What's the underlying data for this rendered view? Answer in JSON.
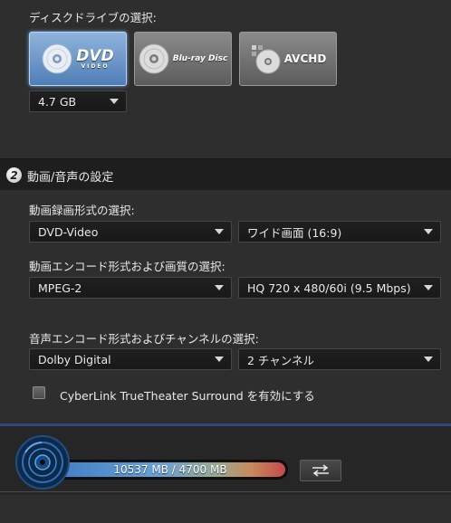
{
  "disc_section": {
    "title": "ディスクドライブの選択:",
    "buttons": [
      {
        "icon": "dvd-disc-icon",
        "brand": "DVD",
        "sub": "VIDEO",
        "selected": true
      },
      {
        "icon": "bluray-disc-icon",
        "brand": "Blu-ray Disc",
        "selected": false
      },
      {
        "icon": "avchd-disc-icon",
        "brand": "AVCHD",
        "selected": false
      }
    ],
    "capacity": "4.7 GB"
  },
  "av_section": {
    "step": "2",
    "title": "動画/音声の設定",
    "video_format_label": "動画録画形式の選択:",
    "video_format": "DVD-Video",
    "aspect": "ワイド画面 (16:9)",
    "video_encode_label": "動画エンコード形式および画質の選択:",
    "video_codec": "MPEG-2",
    "video_quality": "HQ 720 x 480/60i (9.5 Mbps)",
    "audio_encode_label": "音声エンコード形式およびチャンネルの選択:",
    "audio_codec": "Dolby Digital",
    "audio_channels": "2 チャンネル",
    "surround_label": "CyberLink TrueTheater Surround を有効にする",
    "surround_checked": false
  },
  "footer": {
    "capacity_text": "10537 MB / 4700 MB",
    "usage_fraction": 1.0
  }
}
